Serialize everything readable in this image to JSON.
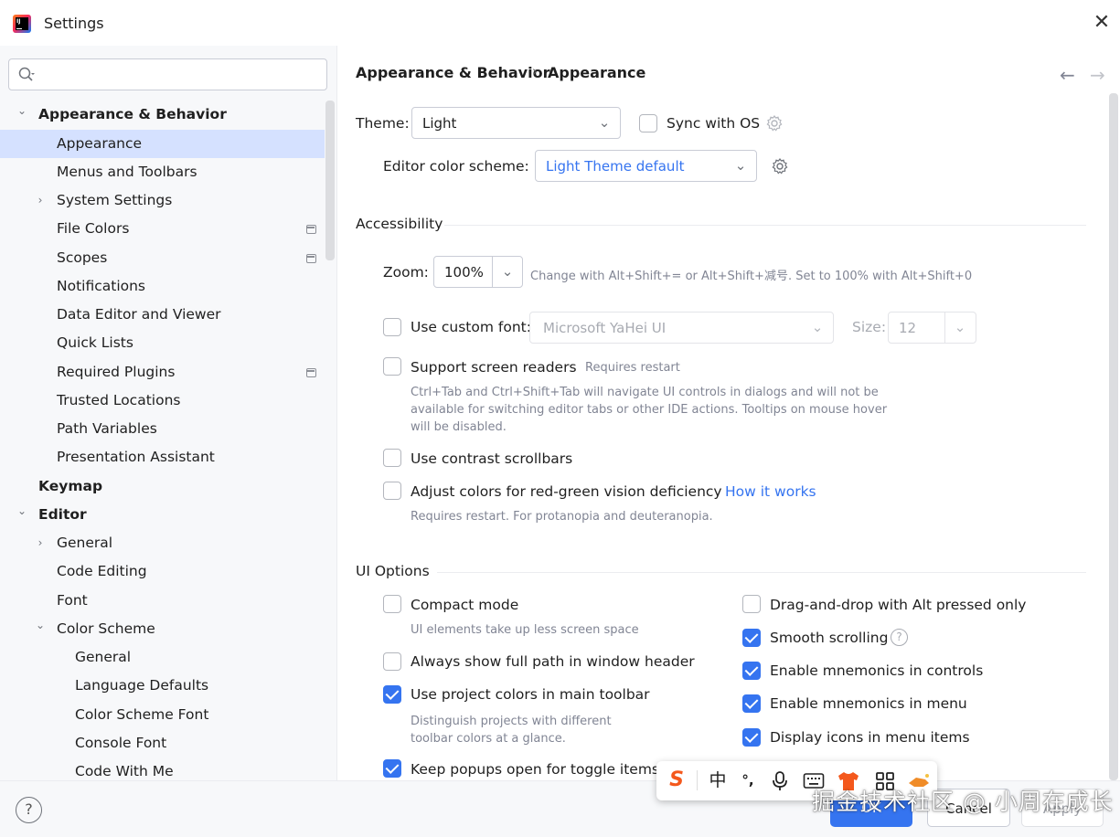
{
  "window": {
    "title": "Settings",
    "close_glyph": "✕"
  },
  "sidebar": {
    "search_placeholder": "",
    "tree": [
      {
        "label": "Appearance & Behavior",
        "bold": true,
        "chevron": "⌄",
        "pin": false
      },
      {
        "label": "Appearance",
        "bold": false,
        "chevron": "",
        "pin": false,
        "selected": true
      },
      {
        "label": "Menus and Toolbars",
        "bold": false,
        "chevron": "",
        "pin": false
      },
      {
        "label": "System Settings",
        "bold": false,
        "chevron": "›",
        "pin": false
      },
      {
        "label": "File Colors",
        "bold": false,
        "chevron": "",
        "pin": true
      },
      {
        "label": "Scopes",
        "bold": false,
        "chevron": "",
        "pin": true
      },
      {
        "label": "Notifications",
        "bold": false,
        "chevron": "",
        "pin": false
      },
      {
        "label": "Data Editor and Viewer",
        "bold": false,
        "chevron": "",
        "pin": false
      },
      {
        "label": "Quick Lists",
        "bold": false,
        "chevron": "",
        "pin": false
      },
      {
        "label": "Required Plugins",
        "bold": false,
        "chevron": "",
        "pin": true
      },
      {
        "label": "Trusted Locations",
        "bold": false,
        "chevron": "",
        "pin": false
      },
      {
        "label": "Path Variables",
        "bold": false,
        "chevron": "",
        "pin": false
      },
      {
        "label": "Presentation Assistant",
        "bold": false,
        "chevron": "",
        "pin": false
      },
      {
        "label": "Keymap",
        "bold": true,
        "chevron": "",
        "pin": false
      },
      {
        "label": "Editor",
        "bold": true,
        "chevron": "⌄",
        "pin": false
      },
      {
        "label": "General",
        "bold": false,
        "chevron": "›",
        "pin": false
      },
      {
        "label": "Code Editing",
        "bold": false,
        "chevron": "",
        "pin": false
      },
      {
        "label": "Font",
        "bold": false,
        "chevron": "",
        "pin": false
      },
      {
        "label": "Color Scheme",
        "bold": false,
        "chevron": "⌄",
        "pin": false
      },
      {
        "label": "General",
        "bold": false,
        "chevron": "",
        "pin": false
      },
      {
        "label": "Language Defaults",
        "bold": false,
        "chevron": "",
        "pin": false
      },
      {
        "label": "Color Scheme Font",
        "bold": false,
        "chevron": "",
        "pin": false
      },
      {
        "label": "Console Font",
        "bold": false,
        "chevron": "",
        "pin": false
      },
      {
        "label": "Code With Me",
        "bold": false,
        "chevron": "",
        "pin": false
      }
    ]
  },
  "breadcrumb": {
    "parent": "Appearance & Behavior",
    "separator": "›",
    "current": "Appearance",
    "back": "←",
    "forward": "→"
  },
  "theme": {
    "label": "Theme:",
    "value": "Light",
    "sync_label": "Sync with OS",
    "sync_checked": false,
    "scheme_label": "Editor color scheme:",
    "scheme_value": "Light Theme default"
  },
  "accessibility": {
    "title": "Accessibility",
    "zoom_label": "Zoom:",
    "zoom_value": "100%",
    "zoom_hint": "Change with Alt+Shift+= or Alt+Shift+减号. Set to 100% with Alt+Shift+0",
    "custom_font_label": "Use custom font:",
    "custom_font_checked": false,
    "custom_font_value": "Microsoft YaHei UI",
    "size_label": "Size:",
    "size_value": "12",
    "screen_readers_label": "Support screen readers",
    "screen_readers_checked": false,
    "screen_readers_tag": "Requires restart",
    "screen_readers_desc": "Ctrl+Tab and Ctrl+Shift+Tab will navigate UI controls in dialogs and will not be available for switching editor tabs or other IDE actions. Tooltips on mouse hover will be disabled.",
    "contrast_label": "Use contrast scrollbars",
    "contrast_checked": false,
    "redgreen_label": "Adjust colors for red-green vision deficiency",
    "redgreen_checked": false,
    "redgreen_link": "How it works",
    "redgreen_hint": "Requires restart. For protanopia and deuteranopia."
  },
  "ui_options": {
    "title": "UI Options",
    "compact_label": "Compact mode",
    "compact_checked": false,
    "compact_hint": "UI elements take up less screen space",
    "fullpath_label": "Always show full path in window header",
    "fullpath_checked": false,
    "projcolors_label": "Use project colors in main toolbar",
    "projcolors_checked": true,
    "projcolors_hint": "Distinguish projects with different toolbar colors at a glance.",
    "popups_label": "Keep popups open for toggle items",
    "popups_checked": true,
    "dnd_label": "Drag-and-drop with Alt pressed only",
    "dnd_checked": false,
    "smooth_label": "Smooth scrolling",
    "smooth_checked": true,
    "mnemonics_controls_label": "Enable mnemonics in controls",
    "mnemonics_controls_checked": true,
    "mnemonics_menu_label": "Enable mnemonics in menu",
    "mnemonics_menu_checked": true,
    "icons_menu_label": "Display icons in menu items",
    "icons_menu_checked": true
  },
  "footer": {
    "help": "?",
    "ok": "OK",
    "cancel": "Cancel",
    "apply": "Apply"
  },
  "ime_toolbar": {
    "logo": "S",
    "mode": "中",
    "punct": "°,",
    "voice": "mic-icon",
    "keyboard": "keyboard-icon",
    "skin": "shirt-icon",
    "apps": "grid-icon",
    "extra": "fox-icon"
  },
  "watermark": "掘金技术社区 @ 小周在成长",
  "colors": {
    "accent": "#3574f0",
    "selection": "#d5e1ff",
    "sidebar_bg": "#f7f8fa"
  }
}
